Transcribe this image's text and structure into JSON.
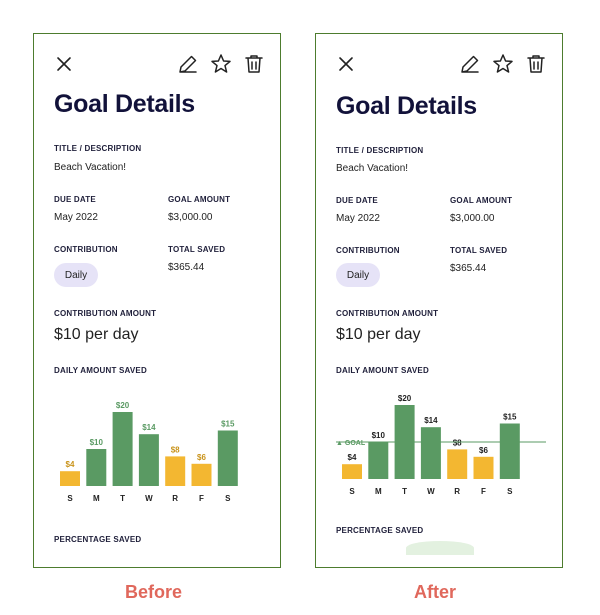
{
  "panels": [
    {
      "caption": "Before",
      "title": "Goal Details",
      "fields": {
        "title_label": "TITLE / DESCRIPTION",
        "title_value": "Beach Vacation!",
        "due_label": "DUE DATE",
        "due_value": "May 2022",
        "goal_label": "GOAL AMOUNT",
        "goal_value": "$3,000.00",
        "contribution_label": "CONTRIBUTION",
        "contribution_value": "Daily",
        "total_label": "TOTAL SAVED",
        "total_value": "$365.44",
        "amount_label": "CONTRIBUTION AMOUNT",
        "amount_value": "$10 per day",
        "daily_label": "DAILY AMOUNT SAVED",
        "percentage_label": "PERCENTAGE SAVED"
      }
    },
    {
      "caption": "After",
      "title": "Goal Details",
      "fields": {
        "title_label": "TITLE / DESCRIPTION",
        "title_value": "Beach Vacation!",
        "due_label": "DUE DATE",
        "due_value": "May 2022",
        "goal_label": "GOAL AMOUNT",
        "goal_value": "$3,000.00",
        "contribution_label": "CONTRIBUTION",
        "contribution_value": "Daily",
        "total_label": "TOTAL SAVED",
        "total_value": "$365.44",
        "amount_label": "CONTRIBUTION AMOUNT",
        "amount_value": "$10 per day",
        "daily_label": "DAILY AMOUNT SAVED",
        "percentage_label": "PERCENTAGE SAVED"
      }
    }
  ],
  "toolbar": {
    "close_icon": "close-icon",
    "edit_icon": "pencil-icon",
    "favorite_icon": "star-icon",
    "delete_icon": "trash-icon"
  },
  "colors": {
    "green": "#5a9a63",
    "yellow": "#f3b731",
    "goal_line": "#5a9a63",
    "border": "#4d7c2e"
  },
  "chart_data": [
    {
      "type": "bar",
      "categories": [
        "S",
        "M",
        "T",
        "W",
        "R",
        "F",
        "S"
      ],
      "values": [
        4,
        10,
        20,
        14,
        8,
        6,
        15
      ],
      "value_labels": [
        "$4",
        "$10",
        "$20",
        "$14",
        "$8",
        "$6",
        "$15"
      ],
      "above_goal": [
        false,
        true,
        true,
        true,
        false,
        false,
        true
      ],
      "goal": 10,
      "goal_label": "",
      "ylim": [
        0,
        20
      ],
      "title": "",
      "xlabel": "",
      "ylabel": ""
    },
    {
      "type": "bar",
      "categories": [
        "S",
        "M",
        "T",
        "W",
        "R",
        "F",
        "S"
      ],
      "values": [
        4,
        10,
        20,
        14,
        8,
        6,
        15
      ],
      "value_labels": [
        "$4",
        "$10",
        "$20",
        "$14",
        "$8",
        "$6",
        "$15"
      ],
      "above_goal": [
        false,
        true,
        true,
        true,
        false,
        false,
        true
      ],
      "goal": 10,
      "goal_label": "▲ GOAL",
      "ylim": [
        0,
        20
      ],
      "title": "",
      "xlabel": "",
      "ylabel": ""
    }
  ]
}
